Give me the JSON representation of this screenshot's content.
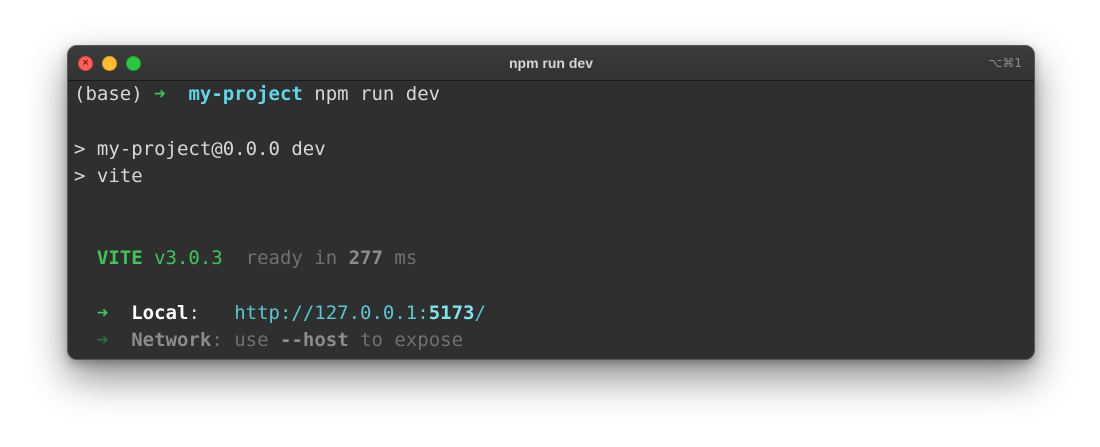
{
  "window": {
    "title": "npm run dev",
    "shortcut": "⌥⌘1"
  },
  "terminal": {
    "prompt_env": "(base)",
    "prompt_arrow": "➜",
    "prompt_dir": "my-project",
    "command": "npm run dev",
    "script_line_1": "> my-project@0.0.0 dev",
    "script_line_2": "> vite",
    "vite_name": "VITE",
    "vite_version": "v3.0.3",
    "ready_prefix": "ready in",
    "ready_time": "277",
    "ready_unit": "ms",
    "local_arrow": "➜",
    "local_label": "Local",
    "local_colon": ":",
    "local_url_prefix": "http://127.0.0.1:",
    "local_url_port": "5173",
    "local_url_suffix": "/",
    "network_arrow": "➜",
    "network_label": "Network",
    "network_colon": ":",
    "network_use": "use",
    "network_flag": "--host",
    "network_to": "to expose"
  },
  "colors": {
    "accent_cyan": "#5fd7e6",
    "accent_green": "#3fc55a",
    "background": "#2f2f2f"
  }
}
